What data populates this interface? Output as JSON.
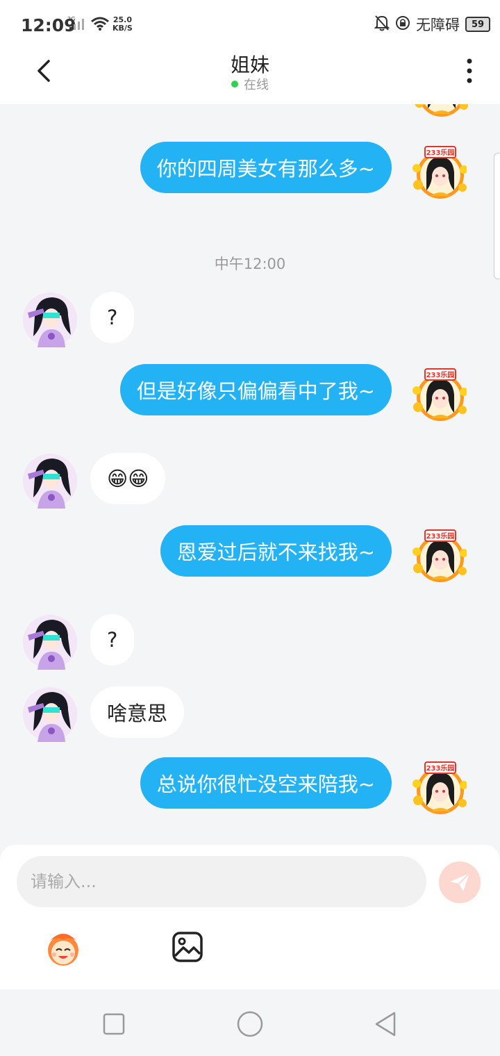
{
  "status_bar": {
    "time": "12:09",
    "network": "2G",
    "speed_value": "25.0",
    "speed_unit": "KB/S",
    "accessibility": "无障碍",
    "battery": "59"
  },
  "header": {
    "title": "姐妹",
    "status": "在线",
    "online_color": "#2fd14e"
  },
  "chat": {
    "timestamp": "中午12:00",
    "messages": [
      {
        "side": "out",
        "text": "你的四周美女有那么多~"
      },
      {
        "side": "in",
        "text": "?"
      },
      {
        "side": "out",
        "text": "但是好像只偏偏看中了我~"
      },
      {
        "side": "in",
        "text": "😁😁"
      },
      {
        "side": "out",
        "text": "恩爱过后就不来找我~"
      },
      {
        "side": "in",
        "text": "?"
      },
      {
        "side": "in",
        "text": "啥意思"
      },
      {
        "side": "out",
        "text": "总说你很忙没空来陪我~"
      }
    ],
    "avatar_badge": "233乐园",
    "bubble_color": "#23b3f5"
  },
  "composer": {
    "placeholder": "请输入...",
    "send_icon": "send-icon",
    "emoji_icon": "emoji-icon",
    "image_icon": "image-icon"
  },
  "navigation": {
    "icons": [
      "recent-apps-icon",
      "home-icon",
      "back-icon"
    ]
  }
}
